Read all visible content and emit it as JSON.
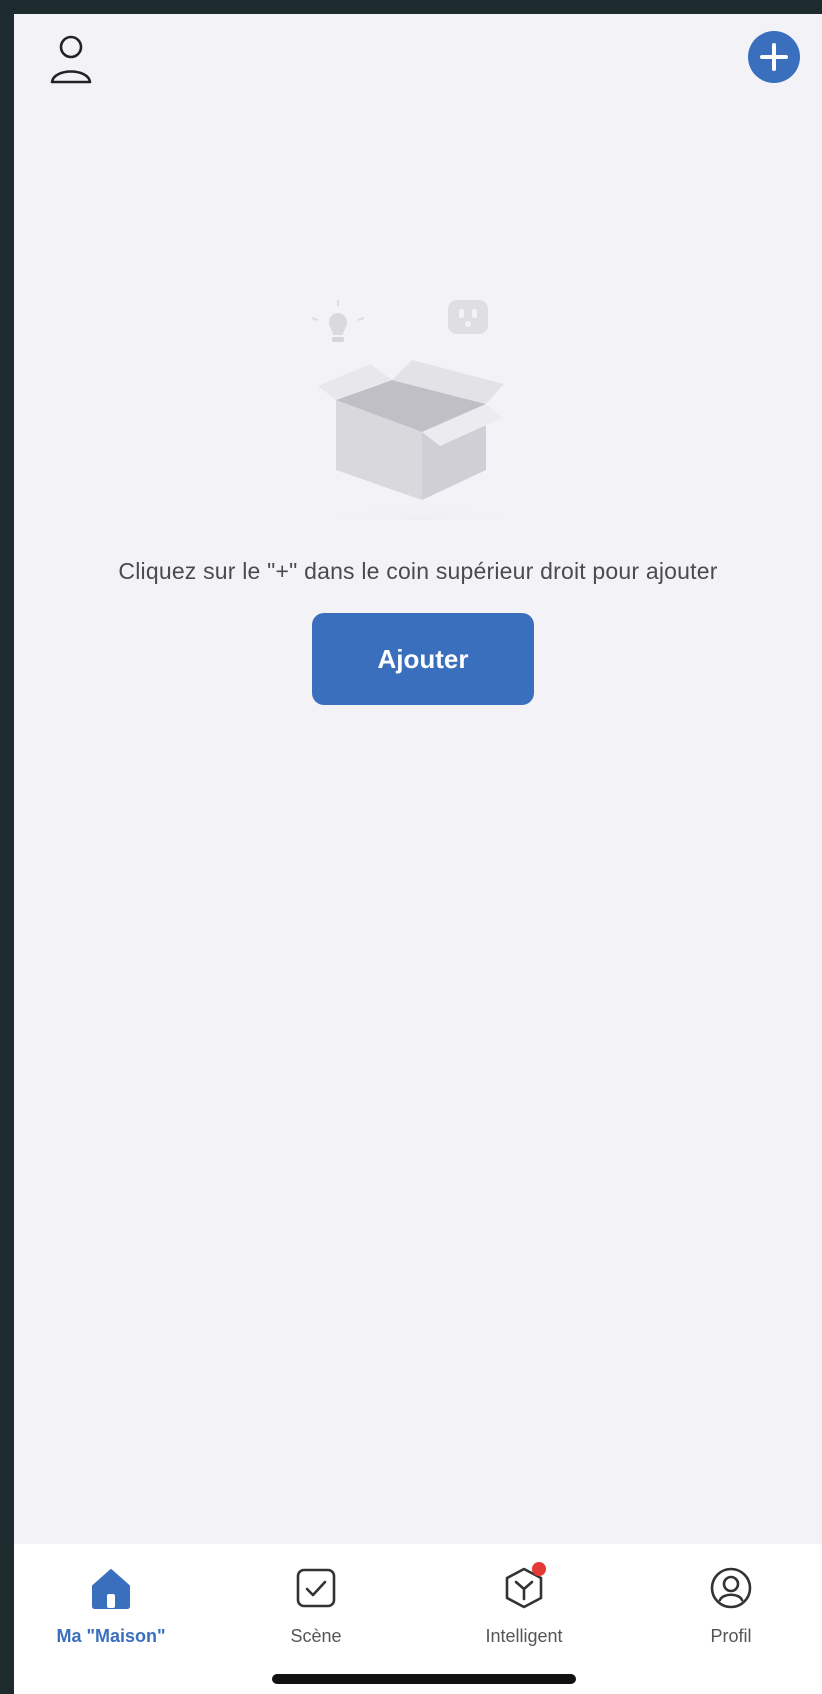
{
  "header": {
    "user_icon": "user-outline-icon",
    "add_icon": "plus-icon"
  },
  "empty_state": {
    "illustration": "empty-box-illustration",
    "hint": "Cliquez sur le \"+\" dans le coin supérieur droit pour ajouter",
    "add_button_label": "Ajouter"
  },
  "tabs": [
    {
      "label": "Ma \"Maison\"",
      "icon": "home-icon",
      "active": true
    },
    {
      "label": "Scène",
      "icon": "scene-checkbox-icon",
      "active": false
    },
    {
      "label": "Intelligent",
      "icon": "smart-cube-icon",
      "active": false,
      "badge": true
    },
    {
      "label": "Profil",
      "icon": "profile-icon",
      "active": false
    }
  ],
  "colors": {
    "accent": "#3a6fbe",
    "background": "#f3f3f7",
    "badge": "#e53935"
  }
}
